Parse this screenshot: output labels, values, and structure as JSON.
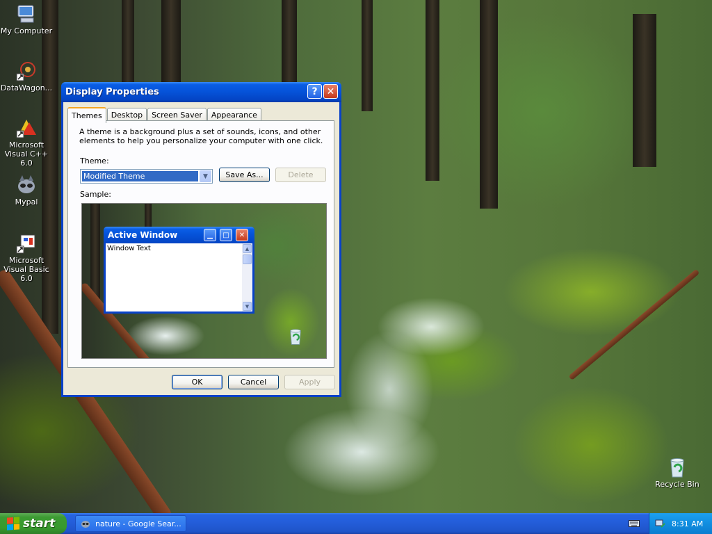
{
  "desktop": {
    "icons": [
      {
        "label": "My Computer",
        "icon": "my-computer-icon"
      },
      {
        "label": "DataWagon...",
        "icon": "datawagon-shortcut-icon"
      },
      {
        "label": "Microsoft Visual C++ 6.0",
        "icon": "visual-cpp-icon"
      },
      {
        "label": "Mypal",
        "icon": "mypal-browser-icon"
      },
      {
        "label": "Microsoft Visual Basic 6.0",
        "icon": "visual-basic-icon"
      },
      {
        "label": "Recycle Bin",
        "icon": "recycle-bin-icon"
      }
    ]
  },
  "window": {
    "title": "Display Properties",
    "help_glyph": "?",
    "close_glyph": "✕",
    "tabs": [
      {
        "label": "Themes",
        "active": true
      },
      {
        "label": "Desktop",
        "active": false
      },
      {
        "label": "Screen Saver",
        "active": false
      },
      {
        "label": "Appearance",
        "active": false
      }
    ],
    "description": "A theme is a background plus a set of sounds, icons, and other elements to help you personalize your computer with one click.",
    "theme_label": "Theme:",
    "theme_value": "Modified Theme",
    "save_as_label": "Save As...",
    "delete_label": "Delete",
    "sample_label": "Sample:",
    "sample_window": {
      "title": "Active Window",
      "body_text": "Window Text"
    },
    "ok_label": "OK",
    "cancel_label": "Cancel",
    "apply_label": "Apply"
  },
  "taskbar": {
    "start_label": "start",
    "task_label": "nature - Google Sear...",
    "clock": "8:31 AM"
  },
  "colors": {
    "titlebar_blue": "#0552d8",
    "start_green": "#379a2e",
    "close_red": "#c4391c",
    "selection_blue": "#316ac5"
  }
}
